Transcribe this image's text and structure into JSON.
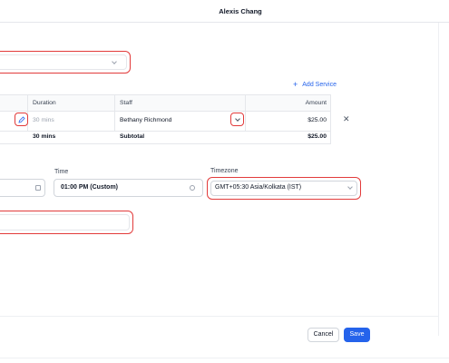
{
  "header": {
    "title": "Alexis Chang"
  },
  "services": {
    "add_service_label": "Add Service",
    "columns": {
      "duration": "Duration",
      "staff": "Staff",
      "amount": "Amount"
    },
    "rows": [
      {
        "duration": "30 mins",
        "staff": "Bethany Richmond",
        "amount": "$25.00"
      }
    ],
    "summary": {
      "duration": "30 mins",
      "label": "Subtotal",
      "amount": "$25.00"
    }
  },
  "schedule": {
    "time_label": "Time",
    "time_value": "01:00 PM (Custom)",
    "timezone_label": "Timezone",
    "timezone_value": "GMT+05:30 Asia/Kolkata (IST)"
  },
  "footer": {
    "cancel_label": "Cancel",
    "save_label": "Save"
  },
  "colors": {
    "accent": "#2563eb",
    "highlight": "#e23b3b"
  }
}
